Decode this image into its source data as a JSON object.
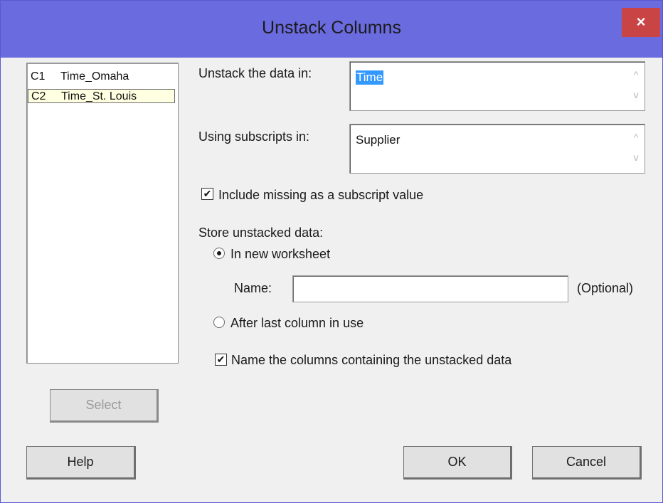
{
  "window": {
    "title": "Unstack Columns",
    "close_glyph": "×"
  },
  "variables": [
    {
      "id": "C1",
      "name": "Time_Omaha",
      "selected": false
    },
    {
      "id": "C2",
      "name": "Time_St. Louis",
      "selected": true
    }
  ],
  "unstack": {
    "label": "Unstack the data in:",
    "value": "Time"
  },
  "subscripts": {
    "label": "Using subscripts in:",
    "value": "Supplier"
  },
  "include_missing": {
    "label": "Include missing as a subscript value",
    "checked": true
  },
  "store": {
    "label": "Store unstacked data:",
    "new_worksheet": {
      "label": "In new worksheet",
      "selected": true
    },
    "name_label": "Name:",
    "name_value": "",
    "optional_label": "(Optional)",
    "after_last": {
      "label": "After last column in use",
      "selected": false
    },
    "name_columns": {
      "label": "Name the columns containing the unstacked data",
      "checked": true
    }
  },
  "buttons": {
    "select": "Select",
    "help": "Help",
    "ok": "OK",
    "cancel": "Cancel"
  },
  "icons": {
    "scroll_up": "^",
    "scroll_down": "v",
    "check": "✔"
  },
  "colors": {
    "titlebar": "#6b6be0",
    "close": "#c94545",
    "selection": "#3399ff"
  }
}
